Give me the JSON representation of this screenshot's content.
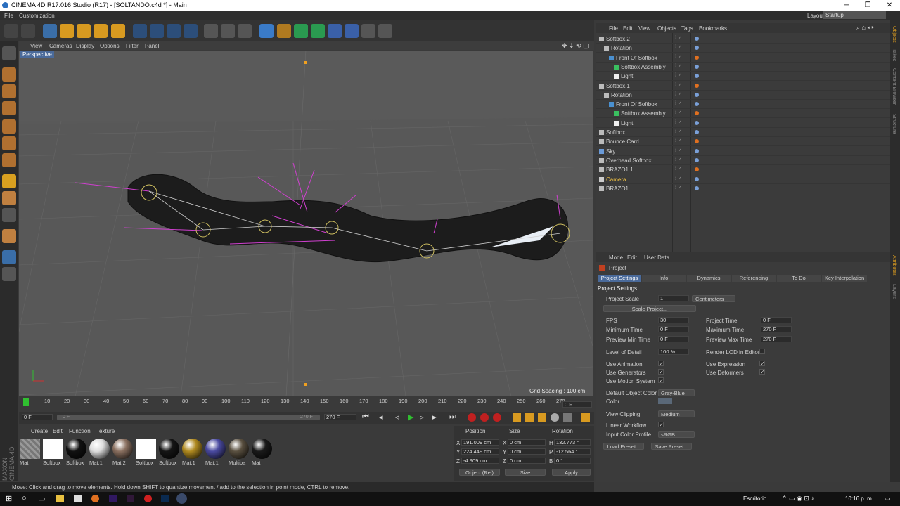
{
  "window": {
    "title": "CINEMA 4D R17.016 Studio (R17) - [SOLTANDO.c4d *] - Main",
    "min": "─",
    "max": "❐",
    "close": "✕"
  },
  "menubar": {
    "items": [
      "File",
      "Customization"
    ],
    "layout_label": "Layout:",
    "layout_value": "Startup"
  },
  "viewport": {
    "menu": [
      "View",
      "Cameras",
      "Display",
      "Options",
      "Filter",
      "Panel"
    ],
    "camera_label": "Perspective",
    "grid_spacing": "Grid Spacing : 100 cm"
  },
  "timeline": {
    "ticks": [
      "0",
      "10",
      "20",
      "30",
      "40",
      "50",
      "60",
      "70",
      "80",
      "90",
      "100",
      "110",
      "120",
      "130",
      "140",
      "150",
      "160",
      "170",
      "180",
      "190",
      "200",
      "210",
      "220",
      "230",
      "240",
      "250",
      "260",
      "270"
    ],
    "current_frame": "0 F"
  },
  "transport": {
    "start": "0 F",
    "range_start": "0 F",
    "range_end": "270 F",
    "end": "270 F"
  },
  "materials": {
    "menu": [
      "Create",
      "Edit",
      "Function",
      "Texture"
    ],
    "items": [
      {
        "label": "Mat",
        "color": "#888",
        "pattern": "stripe"
      },
      {
        "label": "Softbox",
        "color": "#ffffff",
        "pattern": "square"
      },
      {
        "label": "Softbox",
        "color": "#111111",
        "pattern": "ball"
      },
      {
        "label": "Mat.1",
        "color": "#dddddd",
        "pattern": "ball"
      },
      {
        "label": "Mat.2",
        "color": "#8a7060",
        "pattern": "ball"
      },
      {
        "label": "Softbox",
        "color": "#ffffff",
        "pattern": "square"
      },
      {
        "label": "Softbox",
        "color": "#151515",
        "pattern": "ball"
      },
      {
        "label": "Mat.1",
        "color": "#b08a20",
        "pattern": "ball"
      },
      {
        "label": "Mat.1",
        "color": "#4a4aa0",
        "pattern": "ball"
      },
      {
        "label": "Multiba",
        "color": "#5a5040",
        "pattern": "ball"
      },
      {
        "label": "Mat",
        "color": "#1a1a1a",
        "pattern": "ball"
      }
    ]
  },
  "coords": {
    "headers": [
      "Position",
      "Size",
      "Rotation"
    ],
    "rows": [
      {
        "a": "X",
        "pos": "191.009 cm",
        "b": "X",
        "size": "0 cm",
        "c": "H",
        "rot": "132.773 °"
      },
      {
        "a": "Y",
        "pos": "224.449 cm",
        "b": "Y",
        "size": "0 cm",
        "c": "P",
        "rot": "-12.564 °"
      },
      {
        "a": "Z",
        "pos": "-4.909 cm",
        "b": "Z",
        "size": "0 cm",
        "c": "B",
        "rot": "0 °"
      }
    ],
    "mode": "Object (Rel)",
    "size_mode": "Size",
    "apply": "Apply"
  },
  "status": "Move: Click and drag to move elements. Hold down SHIFT to quantize movement / add to the selection in point mode, CTRL to remove.",
  "objmgr": {
    "menu": [
      "File",
      "Edit",
      "View",
      "Objects",
      "Tags",
      "Bookmarks"
    ],
    "rows": [
      {
        "name": "Softbox.2",
        "indent": 0,
        "color": "#cfcfcf"
      },
      {
        "name": "Rotation",
        "indent": 1,
        "color": "#cfcfcf"
      },
      {
        "name": "Front Of Softbox",
        "indent": 2,
        "color": "#cfcfcf"
      },
      {
        "name": "Softbox Assembly",
        "indent": 3,
        "color": "#cfcfcf"
      },
      {
        "name": "Light",
        "indent": 3,
        "color": "#cfcfcf"
      },
      {
        "name": "Softbox.1",
        "indent": 0,
        "color": "#cfcfcf"
      },
      {
        "name": "Rotation",
        "indent": 1,
        "color": "#cfcfcf"
      },
      {
        "name": "Front Of Softbox",
        "indent": 2,
        "color": "#cfcfcf"
      },
      {
        "name": "Softbox Assembly",
        "indent": 3,
        "color": "#cfcfcf"
      },
      {
        "name": "Light",
        "indent": 3,
        "color": "#cfcfcf"
      },
      {
        "name": "Softbox",
        "indent": 0,
        "color": "#cfcfcf"
      },
      {
        "name": "Bounce Card",
        "indent": 0,
        "color": "#cfcfcf"
      },
      {
        "name": "Sky",
        "indent": 0,
        "color": "#cfcfcf"
      },
      {
        "name": "Overhead Softbox",
        "indent": 0,
        "color": "#cfcfcf"
      },
      {
        "name": "BRAZO1.1",
        "indent": 0,
        "color": "#cfcfcf"
      },
      {
        "name": "Camera",
        "indent": 0,
        "color": "#f0c040"
      },
      {
        "name": "BRAZO1",
        "indent": 0,
        "color": "#cfcfcf"
      }
    ]
  },
  "attr": {
    "menu": [
      "Mode",
      "Edit",
      "User Data"
    ],
    "object": "Project",
    "section": "Project Settings",
    "tabs": [
      "Project Settings",
      "Info",
      "Dynamics",
      "Referencing",
      "To Do",
      "Key Interpolation"
    ],
    "project_scale_label": "Project Scale",
    "project_scale": "1",
    "scale_unit": "Centimeters",
    "scale_project": "Scale Project...",
    "fps_label": "FPS",
    "fps": "30",
    "project_time_label": "Project Time",
    "project_time": "0 F",
    "min_time_label": "Minimum Time",
    "min_time": "0 F",
    "max_time_label": "Maximum Time",
    "max_time": "270 F",
    "prev_min_label": "Preview Min Time",
    "prev_min": "0 F",
    "prev_max_label": "Preview Max Time",
    "prev_max": "270 F",
    "lod_label": "Level of Detail",
    "lod": "100 %",
    "render_lod_label": "Render LOD in Editor",
    "use_anim": "Use Animation",
    "use_expr": "Use Expression",
    "use_gen": "Use Generators",
    "use_def": "Use Deformers",
    "use_motion": "Use Motion System",
    "def_color_label": "Default Object Color",
    "def_color": "Gray-Blue",
    "color_label": "Color",
    "view_clip_label": "View Clipping",
    "view_clip": "Medium",
    "linear_wf": "Linear Workflow",
    "icp_label": "Input Color Profile",
    "icp": "sRGB",
    "load": "Load Preset...",
    "save": "Save Preset..."
  },
  "rightstrip": [
    "Objects",
    "Takes",
    "Content Browser",
    "Structure"
  ],
  "rightstrip2": [
    "Attributes",
    "Layers"
  ],
  "taskbar": {
    "desk": "Escritorio",
    "time": "10:16 p. m."
  }
}
